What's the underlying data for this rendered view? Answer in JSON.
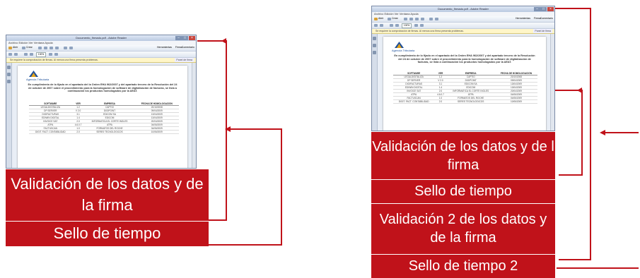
{
  "left": {
    "window": {
      "title": "Documento_firmado.pdf - Adobe Reader",
      "menu": "Archivo   Edición   Ver   Ventana   Ayuda",
      "tool_open": "Abrir",
      "tool_create": "Crear",
      "tool_tools": "Herramientas",
      "tool_sign": "Firmar",
      "tool_comment": "Comentario",
      "infobar": "Se requiere la comprobación de firmas. Al menos una firma presenta problemas.",
      "infobar_button": "Panel de firma",
      "zoom": "100%"
    },
    "document": {
      "logo_text": "Agencia Tributaria",
      "intro": "En cumplimiento de lo fijado en el apartado del la Orden EHA 962/2007 y del apartado tercero de la Resolución del 24 de octubre de 2007 sobre el procedimiento para la homologación de software de digitalización de facturas, se lista a continuación los productos homologados por la AEAT.",
      "headers": [
        "SOFTWARE",
        "VER",
        "EMPRESA",
        "FECHA DE HOMOLOGACIÓN"
      ],
      "rows": [
        [
          "LEGALDIGITALIZA",
          "1.2",
          "CAPTIO",
          "20/10/2008"
        ],
        [
          "DP SERVER",
          "V 2.0",
          "DIGIPOINT",
          "09/04/2009"
        ],
        [
          "DIGIFACTURAS",
          "3.1",
          "EDICOM SA",
          "13/04/2009"
        ],
        [
          "EDIWIN DIGITAL",
          "1.4",
          "EDICOM",
          "13/04/2009"
        ],
        [
          "INVOICE SAT",
          "2.0",
          "INFORMATICA EL CORTE INGLES",
          "20/04/2009"
        ],
        [
          "ATPA",
          "4.6.0.7",
          "ATPA",
          "04/06/2009"
        ],
        [
          "FACTUSCAN",
          "1.0",
          "FORMATOS DEL ROCHE",
          "04/06/2009"
        ],
        [
          "DIGIT. FACT. CONTABILIDAD",
          "2.0",
          "SERES TECNOLÓGICOS",
          "10/06/2009"
        ]
      ]
    },
    "labels": {
      "validation": "Validación de los datos y de la firma",
      "timestamp": "Sello de tiempo"
    }
  },
  "right": {
    "window": {
      "title": "Documento_firmado.pdf - Adobe Reader",
      "menu": "Archivo   Edición   Ver   Ventana   Ayuda",
      "tool_open": "Abrir",
      "tool_create": "Crear",
      "tool_tools": "Herramientas",
      "tool_sign": "Firmar",
      "tool_comment": "Comentario",
      "infobar": "Se requiere la comprobación de firmas. Al menos una firma presenta problemas.",
      "infobar_button": "Panel de firma",
      "zoom": "100%"
    },
    "document": {
      "logo_text": "Agencia Tributaria",
      "intro": "En cumplimiento de lo fijado en el apartado del la Orden EHA 962/2007 y del apartado tercero de la Resolución del 24 de octubre de 2007 sobre el procedimiento para la homologación de software de digitalización de facturas, se lista a continuación los productos homologados por la AEAT.",
      "headers": [
        "SOFTWARE",
        "VER",
        "EMPRESA",
        "FECHA DE HOMOLOGACIÓN"
      ],
      "rows": [
        [
          "LEGALDIGITALIZA",
          "1.2",
          "CAPTIO",
          "20/10/2008"
        ],
        [
          "DP SERVER",
          "V 2.0",
          "DIGIPOINT",
          "09/04/2009"
        ],
        [
          "DIGIFACTURAS",
          "3.1",
          "EDICOM SA",
          "13/04/2009"
        ],
        [
          "EDIWIN DIGITAL",
          "1.4",
          "EDICOM",
          "13/04/2009"
        ],
        [
          "INVOICE SAT",
          "2.0",
          "INFORMATICA EL CORTE INGLES",
          "20/04/2009"
        ],
        [
          "ATPA",
          "4.6.0.7",
          "ATPA",
          "04/06/2009"
        ],
        [
          "FACTUSCAN",
          "1.0",
          "FORMATOS DEL ROCHE",
          "04/06/2009"
        ],
        [
          "DIGIT. FACT. CONTABILIDAD",
          "2.0",
          "SERES TECNOLÓGICOS",
          "10/06/2009"
        ]
      ]
    },
    "labels": {
      "validation1": "Validación de los datos y de l firma",
      "timestamp1": "Sello de tiempo",
      "validation2": "Validación 2 de los datos y de la firma",
      "timestamp2": "Sello de tiempo 2"
    }
  },
  "colors": {
    "label_background": "#c0121a",
    "connector": "#c0121a",
    "label_text": "#ffffff"
  }
}
